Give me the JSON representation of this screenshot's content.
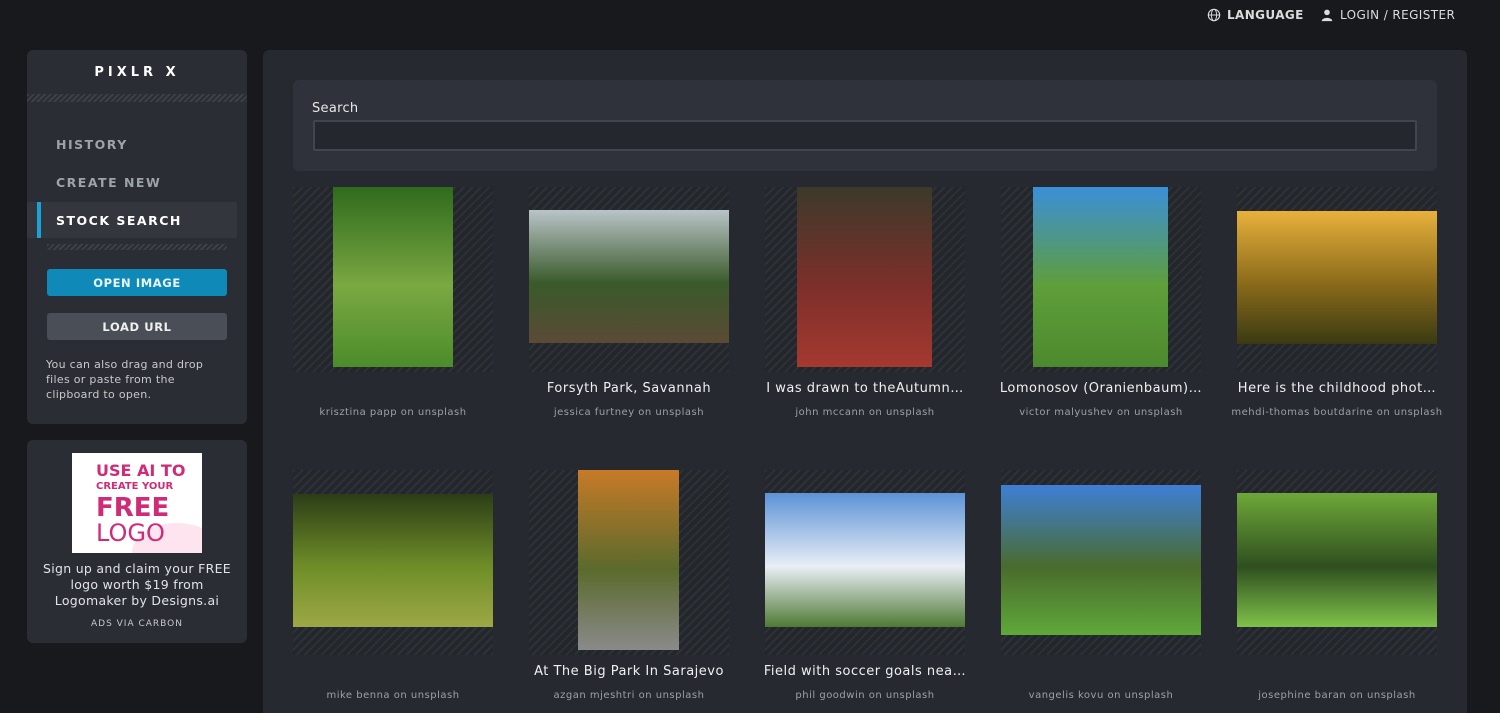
{
  "topbar": {
    "language": "LANGUAGE",
    "login": "LOGIN / REGISTER"
  },
  "sidebar": {
    "brand": "PIXLR X",
    "nav": [
      {
        "label": "HISTORY",
        "active": false
      },
      {
        "label": "CREATE NEW",
        "active": false
      },
      {
        "label": "STOCK SEARCH",
        "active": true
      }
    ],
    "open_image": "OPEN IMAGE",
    "load_url": "LOAD URL",
    "hint": "You can also drag and drop files or paste from the clipboard to open."
  },
  "ad": {
    "logo_line1": "USE AI TO",
    "logo_line2": "CREATE YOUR",
    "logo_line3": "FREE",
    "logo_line4": "LOGO",
    "text": "Sign up and claim your FREE logo worth $19 from Logomaker by Designs.ai",
    "via": "ADS VIA CARBON"
  },
  "search": {
    "label": "Search",
    "value": "",
    "placeholder": ""
  },
  "results": [
    {
      "title": "",
      "credit": "krisztina papp on unsplash",
      "colors": [
        "#2f6a1d",
        "#7aa842",
        "#4c8c2a"
      ]
    },
    {
      "title": "Forsyth Park, Savannah",
      "credit": "jessica furtney on unsplash",
      "colors": [
        "#b9c4c8",
        "#3a5a2a",
        "#5b4a36"
      ]
    },
    {
      "title": "I was drawn to theAutumn…",
      "credit": "john mccann on unsplash",
      "colors": [
        "#3b3a2a",
        "#7d2f2a",
        "#a4392f"
      ]
    },
    {
      "title": "Lomonosov (Oranienbaum)…",
      "credit": "victor malyushev on unsplash",
      "colors": [
        "#3b8fd8",
        "#5f9e3a",
        "#4c8a2e"
      ]
    },
    {
      "title": "Here is the childhood phot…",
      "credit": "mehdi-thomas boutdarine on unsplash",
      "colors": [
        "#e8b13c",
        "#8a6a1a",
        "#3a3a12"
      ]
    },
    {
      "title": "",
      "credit": "mike benna on unsplash",
      "colors": [
        "#2c3d17",
        "#6f8e28",
        "#9da845"
      ]
    },
    {
      "title": "At The Big Park In Sarajevo",
      "credit": "azgan mjeshtri on unsplash",
      "colors": [
        "#c77a28",
        "#5b6a2c",
        "#8a8a8a"
      ]
    },
    {
      "title": "Field with soccer goals nea…",
      "credit": "phil goodwin on unsplash",
      "colors": [
        "#5c93d6",
        "#e9eef5",
        "#4f7a35"
      ]
    },
    {
      "title": "",
      "credit": "vangelis kovu on unsplash",
      "colors": [
        "#3e7fd6",
        "#4a6b2c",
        "#5fa83a"
      ]
    },
    {
      "title": "",
      "credit": "josephine baran on unsplash",
      "colors": [
        "#6ea838",
        "#2f4f1f",
        "#7fc24a"
      ]
    }
  ]
}
